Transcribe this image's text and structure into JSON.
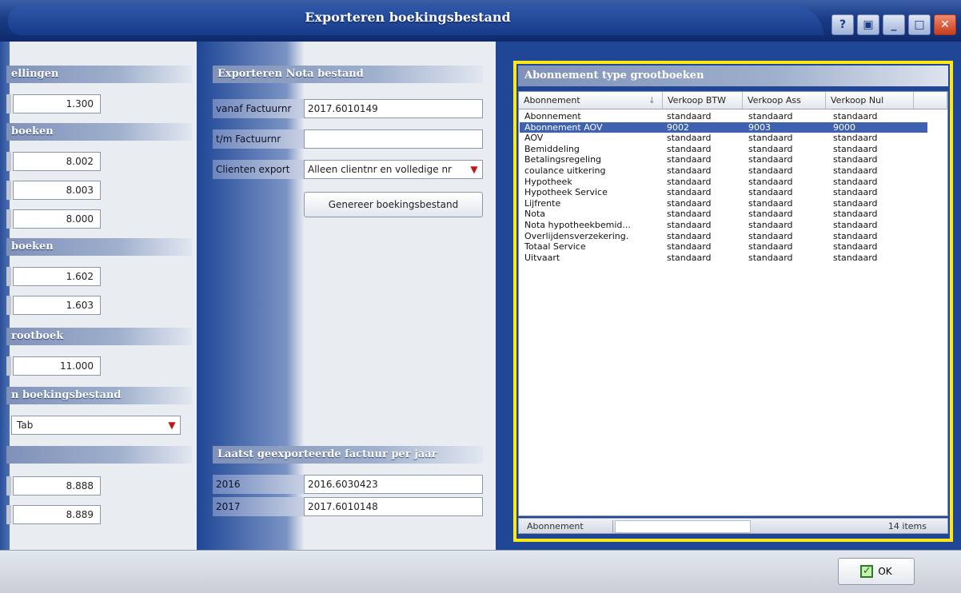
{
  "window": {
    "title": "Exporteren boekingsbestand",
    "buttons": [
      "?",
      "▣",
      "_",
      "□",
      "✕"
    ]
  },
  "left": {
    "sections": [
      {
        "header": "ellingen",
        "values": [
          "1.300"
        ]
      },
      {
        "header": "boeken",
        "values": [
          "8.002",
          "8.003",
          "8.000"
        ]
      },
      {
        "header": "boeken",
        "values": [
          "1.602",
          "1.603"
        ]
      },
      {
        "header": "rootboek",
        "values": [
          "11.000"
        ]
      },
      {
        "header": "n boekingsbestand",
        "select": "Tab"
      },
      {
        "header": "",
        "values": [
          "8.888",
          "8.889"
        ]
      }
    ]
  },
  "middle": {
    "export_header": "Exporteren Nota bestand",
    "fields": [
      {
        "label": "vanaf Factuurnr",
        "value": "2017.6010149"
      },
      {
        "label": "t/m  Factuurnr",
        "value": ""
      },
      {
        "label": "Clienten export",
        "value": "Alleen clientnr en volledige nr"
      }
    ],
    "generate_button": "Genereer boekingsbestand",
    "last_export_header": "Laatst geexporteerde factuur per jaar",
    "last_export": [
      {
        "year": "2016",
        "value": "2016.6030423"
      },
      {
        "year": "2017",
        "value": "2017.6010148"
      }
    ]
  },
  "table": {
    "header": "Abonnement type grootboeken",
    "columns": [
      "Abonnement",
      "Verkoop BTW",
      "Verkoop Ass",
      "Verkoop Nul"
    ],
    "rows": [
      [
        "Abonnement",
        "standaard",
        "standaard",
        "standaard"
      ],
      [
        "Abonnement AOV",
        "9002",
        "9003",
        "9000"
      ],
      [
        "AOV",
        "standaard",
        "standaard",
        "standaard"
      ],
      [
        "Bemiddeling",
        "standaard",
        "standaard",
        "standaard"
      ],
      [
        "Betalingsregeling",
        "standaard",
        "standaard",
        "standaard"
      ],
      [
        "coulance uitkering",
        "standaard",
        "standaard",
        "standaard"
      ],
      [
        "Hypotheek",
        "standaard",
        "standaard",
        "standaard"
      ],
      [
        "Hypotheek Service",
        "standaard",
        "standaard",
        "standaard"
      ],
      [
        "Lijfrente",
        "standaard",
        "standaard",
        "standaard"
      ],
      [
        "Nota",
        "standaard",
        "standaard",
        "standaard"
      ],
      [
        "Nota hypotheekbemid...",
        "standaard",
        "standaard",
        "standaard"
      ],
      [
        "Overlijdensverzekering.",
        "standaard",
        "standaard",
        "standaard"
      ],
      [
        "Totaal Service",
        "standaard",
        "standaard",
        "standaard"
      ],
      [
        "Uitvaart",
        "standaard",
        "standaard",
        "standaard"
      ]
    ],
    "selected_row": 1,
    "sort_icon": "↓",
    "footer_label": "Abonnement",
    "footer_count": "14 items"
  },
  "ok_button": "OK"
}
